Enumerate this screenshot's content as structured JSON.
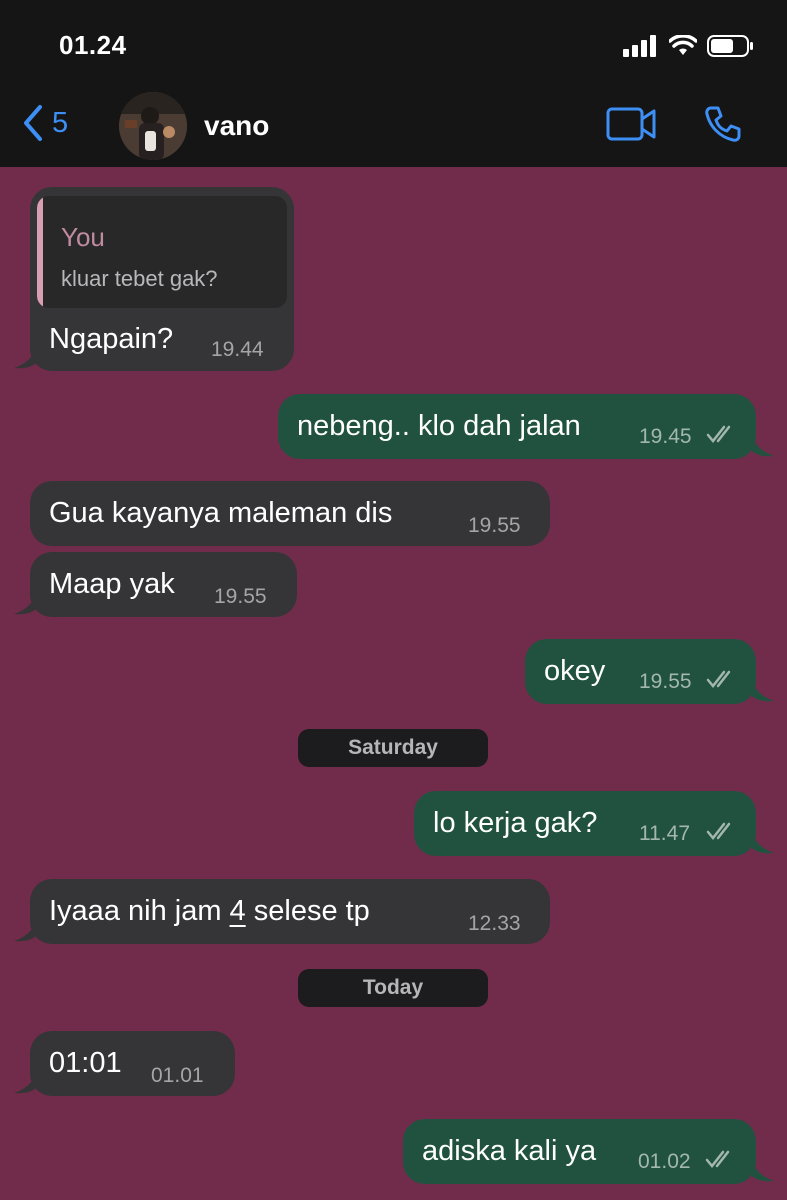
{
  "status_bar": {
    "time": "01.24"
  },
  "header": {
    "back_count": "5",
    "contact_name": "vano",
    "icons": {
      "back": "chevron-left-icon",
      "video": "video-call-icon",
      "call": "phone-call-icon"
    },
    "accent_color": "#3d8ff5"
  },
  "colors": {
    "chat_background": "#722c4b",
    "incoming_bubble": "#353538",
    "outgoing_bubble": "#20523f"
  },
  "messages": [
    {
      "direction": "in",
      "reply_to": {
        "author": "You",
        "text": "kluar tebet gak?"
      },
      "text": "Ngapain?",
      "time": "19.44"
    },
    {
      "direction": "out",
      "text": "nebeng.. klo dah jalan",
      "time": "19.45",
      "read": true
    },
    {
      "direction": "in",
      "text": "Gua kayanya maleman dis",
      "time": "19.55"
    },
    {
      "direction": "in",
      "text": "Maap yak",
      "time": "19.55"
    },
    {
      "direction": "out",
      "text": "okey",
      "time": "19.55",
      "read": true
    },
    {
      "direction": "out",
      "text": "lo kerja gak?",
      "time": "11.47",
      "read": true
    },
    {
      "direction": "in",
      "text_before": "Iyaaa nih jam ",
      "text_link": "4",
      "text_after": " selese tp",
      "time": "12.33"
    },
    {
      "direction": "in",
      "text": "01:01",
      "time": "01.01"
    },
    {
      "direction": "out",
      "text": "adiska kali ya",
      "time": "01.02",
      "read": true
    }
  ],
  "date_separators": [
    "Saturday",
    "Today"
  ]
}
